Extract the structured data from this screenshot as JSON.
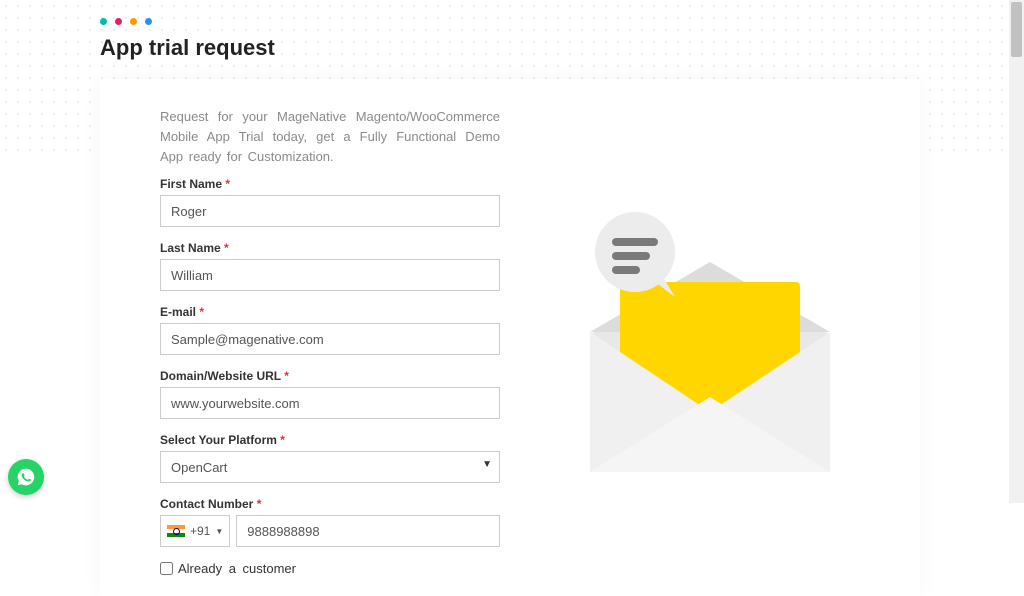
{
  "page": {
    "title": "App trial request",
    "intro": "Request for your MageNative Magento/WooCommerce Mobile App Trial today, get a Fully Functional Demo App ready for Customization."
  },
  "form": {
    "first_name": {
      "label": "First Name",
      "value": "Roger"
    },
    "last_name": {
      "label": "Last Name",
      "value": "William"
    },
    "email": {
      "label": "E-mail",
      "value": "Sample@magenative.com"
    },
    "domain": {
      "label": "Domain/Website URL",
      "value": "www.yourwebsite.com"
    },
    "platform": {
      "label": "Select Your Platform",
      "value": "OpenCart"
    },
    "phone": {
      "label": "Contact Number",
      "country_code": "+91",
      "value": "9888988898"
    },
    "already_customer": {
      "label": "Already  a  customer",
      "checked": false
    }
  },
  "required_mark": "*"
}
